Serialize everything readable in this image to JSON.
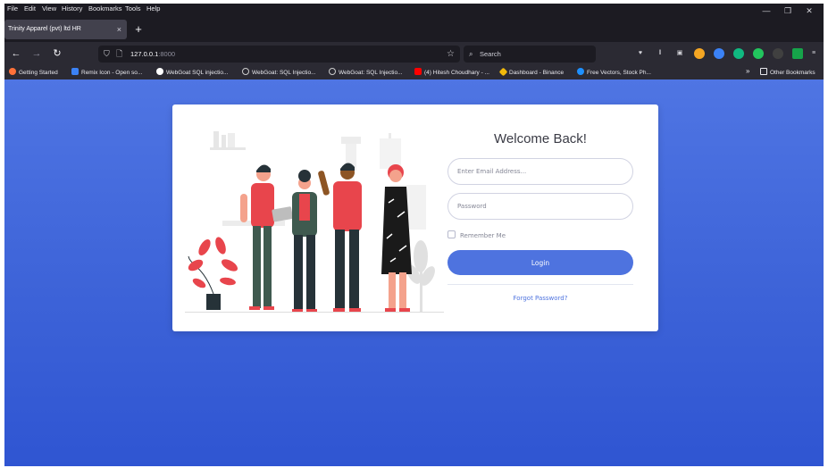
{
  "menubar": {
    "items": [
      "File",
      "Edit",
      "View",
      "History",
      "Bookmarks",
      "Tools",
      "Help"
    ]
  },
  "window_controls": {
    "minimize": "—",
    "restore": "❐",
    "close": "✕"
  },
  "tab": {
    "title": "Trinity Apparel (pvt) ltd HR",
    "close": "×",
    "new_tab": "+"
  },
  "nav": {
    "back": "←",
    "forward": "→",
    "reload": "↻",
    "url_host": "127.0.0.1",
    "url_port": ":8000",
    "search_placeholder": "Search"
  },
  "bookmarks": {
    "items": [
      {
        "label": "Getting Started",
        "color": "#ff7139"
      },
      {
        "label": "Remix Icon - Open so...",
        "color": "#3b82f6"
      },
      {
        "label": "WebGoat SQL injectio...",
        "color": "#ffffff"
      },
      {
        "label": "WebGoat: SQL Injectio...",
        "color": "#cccccc"
      },
      {
        "label": "WebGoat: SQL Injectio...",
        "color": "#cccccc"
      },
      {
        "label": "(4) Hitesh Choudhary - ...",
        "color": "#ff0000"
      },
      {
        "label": "Dashboard - Binance",
        "color": "#f0b90b"
      },
      {
        "label": "Free Vectors, Stock Ph...",
        "color": "#1e90ff"
      }
    ],
    "more": "»",
    "other": "Other Bookmarks"
  },
  "login": {
    "title": "Welcome Back!",
    "email_placeholder": "Enter Email Address...",
    "password_placeholder": "Password",
    "remember_label": "Remember Me",
    "login_label": "Login",
    "forgot_label": "Forgot Password?"
  },
  "colors": {
    "primary": "#4e73df",
    "browser_bg": "#1c1b22",
    "toolbar_bg": "#2b2a33",
    "accent_red": "#e8454c"
  }
}
